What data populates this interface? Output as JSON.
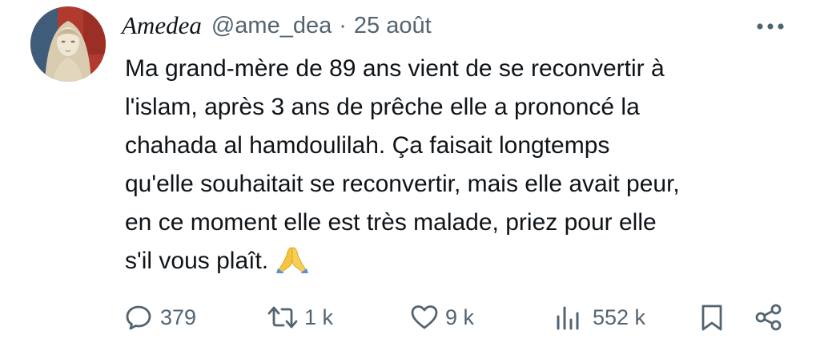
{
  "tweet": {
    "display_name": "Amedea",
    "handle": "@ame_dea",
    "separator": "·",
    "date": "25 août",
    "text_lines": [
      "Ma grand-mère de 89 ans vient de se reconvertir à",
      "l'islam, après 3 ans de prêche elle a prononcé la",
      "chahada al hamdoulilah. Ça faisait longtemps",
      "qu'elle souhaitait se reconvertir, mais elle avait peur,",
      "en ce moment elle est très malade, priez pour elle",
      "s'il vous plaît."
    ],
    "emoji": "🙏"
  },
  "metrics": {
    "replies": "379",
    "reposts": "1 k",
    "likes": "9 k",
    "views": "552 k"
  },
  "icons": {
    "avatar": "avatar",
    "more": "more-dots-icon",
    "reply": "reply-bubble-icon",
    "repost": "repost-icon",
    "like": "heart-icon",
    "views": "views-bar-icon",
    "bookmark": "bookmark-icon",
    "share": "share-icon",
    "emoji": "praying-hands-icon"
  },
  "colors": {
    "text": "#0f1419",
    "secondary": "#536471",
    "background": "#ffffff"
  }
}
